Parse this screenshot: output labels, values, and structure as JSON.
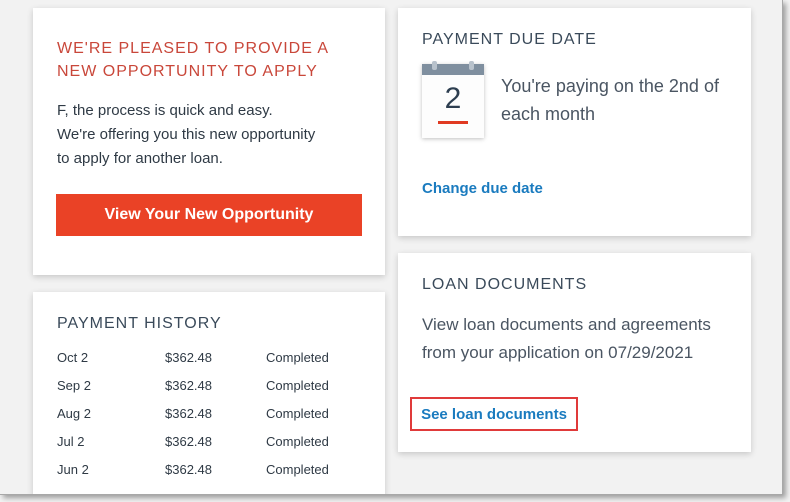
{
  "promo": {
    "heading": "WE'RE PLEASED TO PROVIDE A NEW OPPORTUNITY TO APPLY",
    "body_lines": [
      "F, the process is quick and easy.",
      "We're offering you this new opportunity",
      "to apply for another loan."
    ],
    "button_label": "View Your New Opportunity",
    "button_color": "#ea4226"
  },
  "due_date": {
    "title": "PAYMENT DUE DATE",
    "calendar_day": "2",
    "description": "You're paying on the 2nd of each month",
    "change_link": "Change due date"
  },
  "loan_docs": {
    "title": "LOAN DOCUMENTS",
    "description": "View loan documents and agreements from your application on 07/29/2021",
    "link": "See loan documents",
    "highlight_color": "#e03a3a"
  },
  "history": {
    "title": "PAYMENT HISTORY",
    "rows": [
      {
        "date": "Oct 2",
        "amount": "$362.48",
        "status": "Completed"
      },
      {
        "date": "Sep 2",
        "amount": "$362.48",
        "status": "Completed"
      },
      {
        "date": "Aug 2",
        "amount": "$362.48",
        "status": "Completed"
      },
      {
        "date": "Jul 2",
        "amount": "$362.48",
        "status": "Completed"
      },
      {
        "date": "Jun 2",
        "amount": "$362.48",
        "status": "Completed"
      }
    ]
  },
  "colors": {
    "link": "#1a7bbf",
    "heading_accent": "#c9473a"
  },
  "icons": {
    "calendar": "calendar-icon"
  }
}
